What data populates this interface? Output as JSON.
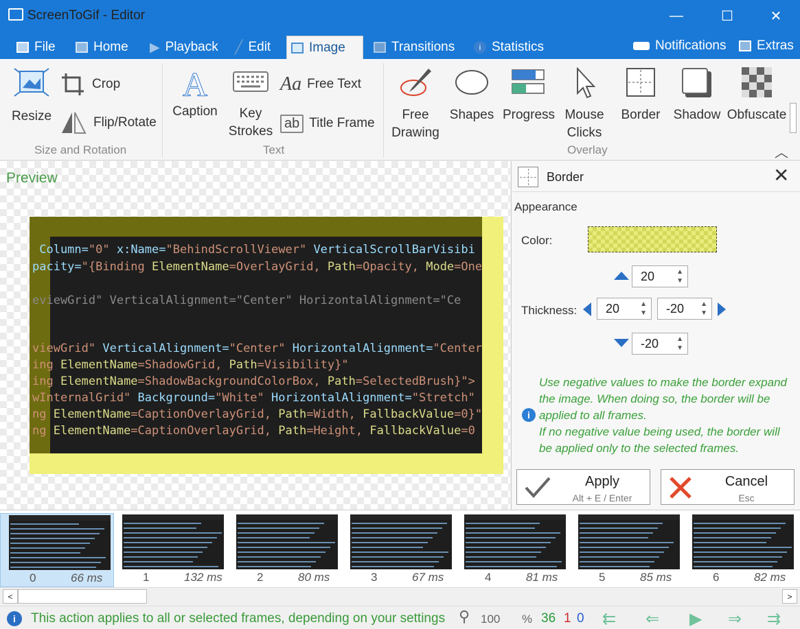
{
  "window": {
    "title": "ScreenToGif - Editor",
    "min": "—",
    "max": "☐",
    "close": "✕"
  },
  "tabs": [
    {
      "label": "File",
      "icon": "save-icon"
    },
    {
      "label": "Home",
      "icon": "image-icon"
    },
    {
      "label": "Playback",
      "icon": "play-icon"
    },
    {
      "label": "Edit",
      "icon": "pencil-icon"
    },
    {
      "label": "Image",
      "icon": "picture-icon",
      "active": true
    },
    {
      "label": "Transitions",
      "icon": "transitions-icon"
    },
    {
      "label": "Statistics",
      "icon": "info-icon"
    }
  ],
  "top_right": {
    "notifications": "Notifications",
    "extras": "Extras"
  },
  "ribbon": {
    "size_rotation": {
      "resize": "Resize",
      "crop": "Crop",
      "flip_rotate": "Flip/Rotate",
      "group": "Size and Rotation"
    },
    "text": {
      "caption": "Caption",
      "key_strokes_1": "Key",
      "key_strokes_2": "Strokes",
      "free_text": "Free Text",
      "title_frame": "Title Frame",
      "group": "Text"
    },
    "overlay": {
      "free_drawing_1": "Free",
      "free_drawing_2": "Drawing",
      "shapes": "Shapes",
      "progress": "Progress",
      "mouse_clicks_1": "Mouse",
      "mouse_clicks_2": "Clicks",
      "border": "Border",
      "shadow": "Shadow",
      "obfuscate": "Obfuscate",
      "group": "Overlay"
    }
  },
  "preview": {
    "label": "Preview"
  },
  "code_lines": [
    {
      "segs": [
        [
          " Column=",
          "#9cdcfe"
        ],
        [
          "\"0\"",
          "#ce9178"
        ],
        [
          " x:Name=",
          "#9cdcfe"
        ],
        [
          "\"BehindScrollViewer\"",
          "#ce9178"
        ],
        [
          " VerticalScrollBarVisibi",
          "#9cdcfe"
        ]
      ]
    },
    {
      "segs": [
        [
          "pacity=",
          "#9cdcfe"
        ],
        [
          "\"{Binding ",
          "#ce9178"
        ],
        [
          "ElementName",
          "#dcdc8a"
        ],
        [
          "=OverlayGrid, ",
          "#ce9178"
        ],
        [
          "Path",
          "#dcdc8a"
        ],
        [
          "=Opacity, ",
          "#ce9178"
        ],
        [
          "Mode",
          "#dcdc8a"
        ],
        [
          "=One",
          "#ce9178"
        ]
      ]
    },
    {
      "segs": [
        [
          "eviewGrid\" VerticalAlignment=\"Center\" HorizontalAlignment=\"Ce",
          "#8a8a8a"
        ]
      ]
    },
    {
      "segs": [
        [
          "viewGrid\"",
          "#ce9178"
        ],
        [
          " VerticalAlignment=",
          "#9cdcfe"
        ],
        [
          "\"Center\"",
          "#ce9178"
        ],
        [
          " HorizontalAlignment=",
          "#9cdcfe"
        ],
        [
          "\"Center",
          "#ce9178"
        ]
      ]
    },
    {
      "segs": [
        [
          "ing ",
          "#ce9178"
        ],
        [
          "ElementName",
          "#dcdc8a"
        ],
        [
          "=ShadowGrid, ",
          "#ce9178"
        ],
        [
          "Path",
          "#dcdc8a"
        ],
        [
          "=Visibility}\"",
          "#ce9178"
        ]
      ]
    },
    {
      "segs": [
        [
          "ing ",
          "#ce9178"
        ],
        [
          "ElementName",
          "#dcdc8a"
        ],
        [
          "=ShadowBackgroundColorBox, ",
          "#ce9178"
        ],
        [
          "Path",
          "#dcdc8a"
        ],
        [
          "=SelectedBrush}\">",
          "#ce9178"
        ]
      ]
    },
    {
      "segs": [
        [
          "wInternalGrid\"",
          "#ce9178"
        ],
        [
          " Background=",
          "#9cdcfe"
        ],
        [
          "\"White\"",
          "#ce9178"
        ],
        [
          " HorizontalAlignment=",
          "#9cdcfe"
        ],
        [
          "\"Stretch\"",
          "#ce9178"
        ]
      ]
    },
    {
      "segs": [
        [
          "ng ",
          "#ce9178"
        ],
        [
          "ElementName",
          "#dcdc8a"
        ],
        [
          "=CaptionOverlayGrid, ",
          "#ce9178"
        ],
        [
          "Path",
          "#dcdc8a"
        ],
        [
          "=Width, ",
          "#ce9178"
        ],
        [
          "FallbackValue",
          "#dcdc8a"
        ],
        [
          "=0}\"",
          "#ce9178"
        ]
      ]
    },
    {
      "segs": [
        [
          "ng ",
          "#ce9178"
        ],
        [
          "ElementName",
          "#dcdc8a"
        ],
        [
          "=CaptionOverlayGrid, ",
          "#ce9178"
        ],
        [
          "Path",
          "#dcdc8a"
        ],
        [
          "=Height, ",
          "#ce9178"
        ],
        [
          "FallbackValue",
          "#dcdc8a"
        ],
        [
          "=0",
          "#ce9178"
        ]
      ]
    }
  ],
  "panel": {
    "title": "Border",
    "appearance": "Appearance",
    "color_label": "Color:",
    "color_value": "#e8ec7a",
    "thickness_label": "Thickness:",
    "top": "20",
    "left": "20",
    "right": "-20",
    "bottom": "-20",
    "hint": "Use negative values to make the border expand the image. When doing so, the border will be applied to all frames.\nIf no negative value being used, the border will be applied only to the selected frames.",
    "apply": {
      "label": "Apply",
      "shortcut": "Alt + E / Enter"
    },
    "cancel": {
      "label": "Cancel",
      "shortcut": "Esc"
    }
  },
  "frames": [
    {
      "num": "0",
      "ms": "66 ms",
      "selected": true
    },
    {
      "num": "1",
      "ms": "132 ms"
    },
    {
      "num": "2",
      "ms": "80 ms"
    },
    {
      "num": "3",
      "ms": "67 ms"
    },
    {
      "num": "4",
      "ms": "81 ms"
    },
    {
      "num": "5",
      "ms": "85 ms"
    },
    {
      "num": "6",
      "ms": "82 ms"
    }
  ],
  "status": {
    "message": "This action applies to all or selected frames, depending on your settings",
    "zoom": "100",
    "zoom_unit": "%",
    "total": "36",
    "selected": "1",
    "current": "0"
  }
}
